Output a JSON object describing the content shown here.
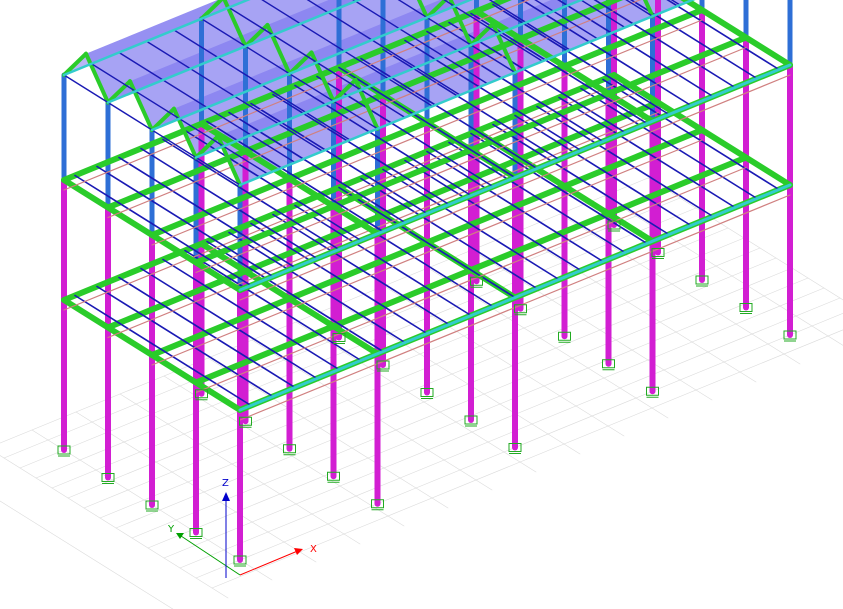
{
  "view": {
    "type": "3d-structural-model-viewport",
    "background_color": "#ffffff"
  },
  "axes": {
    "x_label": "X",
    "y_label": "Y",
    "z_label": "Z",
    "x_color": "#ff0000",
    "y_color": "#00a000",
    "z_color": "#0000cc"
  },
  "colors": {
    "columns": "#d21ed2",
    "upper_columns": "#2e6fd6",
    "floor_beams": "#2acc2a",
    "secondary_beams": "#1a1ab4",
    "trusses": "#d08080",
    "edge_beams": "#33cccc",
    "roof_panels": "#8a84f0",
    "supports": "#22aa22",
    "grid": "#dcdcdc"
  },
  "icons": {
    "support": "fixed-support-icon"
  }
}
